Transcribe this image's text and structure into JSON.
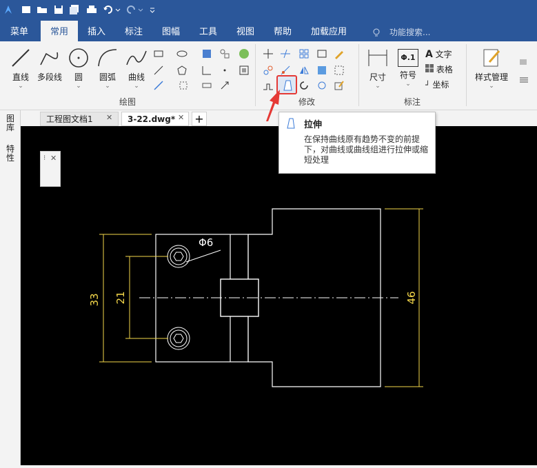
{
  "tabs": [
    "菜单",
    "常用",
    "插入",
    "标注",
    "图幅",
    "工具",
    "视图",
    "帮助",
    "加载应用"
  ],
  "search": {
    "placeholder": "功能搜索..."
  },
  "draw_tools": [
    "直线",
    "多段线",
    "圆",
    "圆弧",
    "曲线"
  ],
  "dim_tools": [
    "尺寸",
    "符号"
  ],
  "dim_text_items": [
    "文字",
    "表格",
    "坐标"
  ],
  "symbol_icon_text": "Φ.1",
  "style_tool": "样式管理",
  "groups": {
    "draw": "绘图",
    "modify": "修改",
    "dim": "标注"
  },
  "doc_tabs": [
    "工程图文档1",
    "3-22.dwg*"
  ],
  "side_panels": [
    "图库",
    "特性"
  ],
  "tooltip": {
    "title": "拉伸",
    "desc": "在保持曲线原有趋势不变的前提下，对曲线或曲线组进行拉伸或缩短处理"
  },
  "drawing": {
    "dims": [
      "33",
      "21",
      "46"
    ],
    "diameter": "Φ6"
  },
  "colors": {
    "ribbon_blue": "#2b579a",
    "dim_yellow": "#f5d84a",
    "highlight_red": "#e53935"
  }
}
